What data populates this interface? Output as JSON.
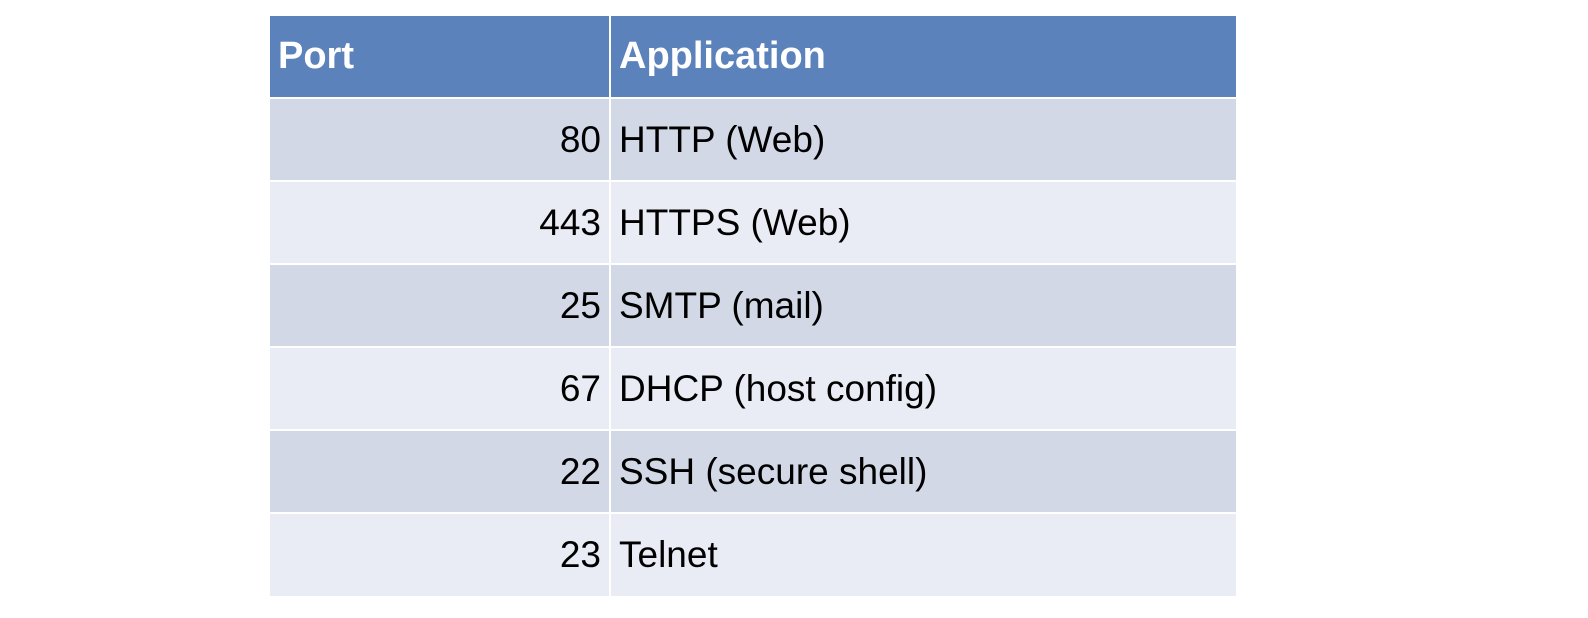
{
  "table": {
    "headers": {
      "port": "Port",
      "application": "Application"
    },
    "rows": [
      {
        "port": "80",
        "application": "HTTP (Web)"
      },
      {
        "port": "443",
        "application": "HTTPS (Web)"
      },
      {
        "port": "25",
        "application": "SMTP (mail)"
      },
      {
        "port": "67",
        "application": "DHCP (host config)"
      },
      {
        "port": "22",
        "application": "SSH (secure shell)"
      },
      {
        "port": "23",
        "application": "Telnet"
      }
    ]
  },
  "colors": {
    "header_bg": "#5b82bb",
    "header_text": "#ffffff",
    "row_band_dark": "#d2d8e6",
    "row_band_light": "#e9ecf4"
  }
}
